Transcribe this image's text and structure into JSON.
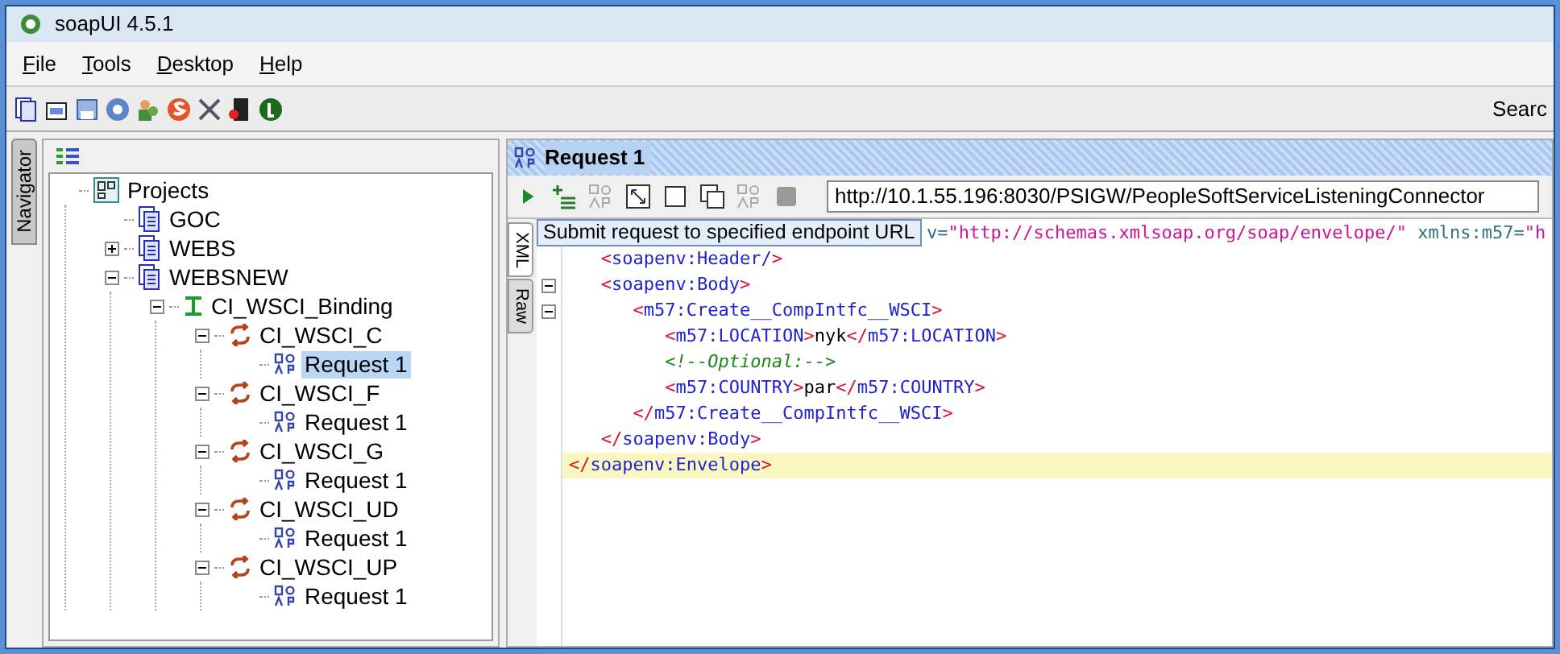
{
  "window": {
    "title": "soapUI 4.5.1"
  },
  "menu": [
    {
      "label": "File"
    },
    {
      "label": "Tools"
    },
    {
      "label": "Desktop"
    },
    {
      "label": "Help"
    }
  ],
  "toolbar": {
    "search_label": "Searc"
  },
  "navigator": {
    "tab": "Navigator",
    "tree": [
      {
        "label": "Projects",
        "kind": "root",
        "selected": false,
        "children": [
          {
            "label": "GOC",
            "kind": "project",
            "selected": false
          },
          {
            "label": "WEBS",
            "kind": "project",
            "expanded": false,
            "selected": false
          },
          {
            "label": "WEBSNEW",
            "kind": "project",
            "expanded": true,
            "selected": false,
            "children": [
              {
                "label": "CI_WSCI_Binding",
                "kind": "interface",
                "expanded": true,
                "selected": false,
                "children": [
                  {
                    "label": "CI_WSCI_C",
                    "kind": "operation",
                    "expanded": true,
                    "selected": false,
                    "children": [
                      {
                        "label": "Request 1",
                        "kind": "request",
                        "selected": true
                      }
                    ]
                  },
                  {
                    "label": "CI_WSCI_F",
                    "kind": "operation",
                    "expanded": true,
                    "selected": false,
                    "children": [
                      {
                        "label": "Request 1",
                        "kind": "request",
                        "selected": false
                      }
                    ]
                  },
                  {
                    "label": "CI_WSCI_G",
                    "kind": "operation",
                    "expanded": true,
                    "selected": false,
                    "children": [
                      {
                        "label": "Request 1",
                        "kind": "request",
                        "selected": false
                      }
                    ]
                  },
                  {
                    "label": "CI_WSCI_UD",
                    "kind": "operation",
                    "expanded": true,
                    "selected": false,
                    "children": [
                      {
                        "label": "Request 1",
                        "kind": "request",
                        "selected": false
                      }
                    ]
                  },
                  {
                    "label": "CI_WSCI_UP",
                    "kind": "operation",
                    "expanded": true,
                    "selected": false,
                    "children": [
                      {
                        "label": "Request 1",
                        "kind": "request",
                        "selected": false
                      }
                    ]
                  }
                ]
              }
            ]
          }
        ]
      }
    ]
  },
  "request": {
    "title": "Request 1",
    "endpoint": "http://10.1.55.196:8030/PSIGW/PeopleSoftServiceListeningConnector",
    "tooltip": "Submit request to specified endpoint URL",
    "tabs": [
      {
        "label": "XML",
        "selected": true
      },
      {
        "label": "Raw",
        "selected": false
      }
    ],
    "lines": [
      {
        "fold": false,
        "highlighted": false,
        "segments": [
          {
            "kind": "attr",
            "text": "v="
          },
          {
            "kind": "value",
            "text": "\"http://schemas.xmlsoap.org/soap/envelope/\""
          },
          {
            "kind": "attr",
            "text": " xmlns:m57="
          },
          {
            "kind": "value",
            "text": "\"h"
          }
        ]
      },
      {
        "fold": false,
        "highlighted": false,
        "segments": [
          {
            "kind": "bracket",
            "text": "   <"
          },
          {
            "kind": "tag",
            "text": "soapenv:Header/"
          },
          {
            "kind": "bracket",
            "text": ">"
          }
        ]
      },
      {
        "fold": true,
        "highlighted": false,
        "segments": [
          {
            "kind": "bracket",
            "text": "   <"
          },
          {
            "kind": "tag",
            "text": "soapenv:Body"
          },
          {
            "kind": "bracket",
            "text": ">"
          }
        ]
      },
      {
        "fold": true,
        "highlighted": false,
        "segments": [
          {
            "kind": "bracket",
            "text": "      <"
          },
          {
            "kind": "tag",
            "text": "m57:Create__CompIntfc__WSCI"
          },
          {
            "kind": "bracket",
            "text": ">"
          }
        ]
      },
      {
        "fold": false,
        "highlighted": false,
        "segments": [
          {
            "kind": "bracket",
            "text": "         <"
          },
          {
            "kind": "tag",
            "text": "m57:LOCATION"
          },
          {
            "kind": "bracket",
            "text": ">"
          },
          {
            "kind": "text",
            "text": "nyk"
          },
          {
            "kind": "bracket",
            "text": "</"
          },
          {
            "kind": "tag",
            "text": "m57:LOCATION"
          },
          {
            "kind": "bracket",
            "text": ">"
          }
        ]
      },
      {
        "fold": false,
        "highlighted": false,
        "segments": [
          {
            "kind": "comment",
            "text": "         <!--Optional:-->"
          }
        ]
      },
      {
        "fold": false,
        "highlighted": false,
        "segments": [
          {
            "kind": "bracket",
            "text": "         <"
          },
          {
            "kind": "tag",
            "text": "m57:COUNTRY"
          },
          {
            "kind": "bracket",
            "text": ">"
          },
          {
            "kind": "text",
            "text": "par"
          },
          {
            "kind": "bracket",
            "text": "</"
          },
          {
            "kind": "tag",
            "text": "m57:COUNTRY"
          },
          {
            "kind": "bracket",
            "text": ">"
          }
        ]
      },
      {
        "fold": false,
        "highlighted": false,
        "segments": [
          {
            "kind": "bracket",
            "text": "      </"
          },
          {
            "kind": "tag",
            "text": "m57:Create__CompIntfc__WSCI"
          },
          {
            "kind": "bracket",
            "text": ">"
          }
        ]
      },
      {
        "fold": false,
        "highlighted": false,
        "segments": [
          {
            "kind": "bracket",
            "text": "   </"
          },
          {
            "kind": "tag",
            "text": "soapenv:Body"
          },
          {
            "kind": "bracket",
            "text": ">"
          }
        ]
      },
      {
        "fold": false,
        "highlighted": true,
        "segments": [
          {
            "kind": "bracket",
            "text": "</"
          },
          {
            "kind": "tag",
            "text": "soapenv:Envelope"
          },
          {
            "kind": "bracket",
            "text": ">"
          }
        ]
      }
    ]
  }
}
